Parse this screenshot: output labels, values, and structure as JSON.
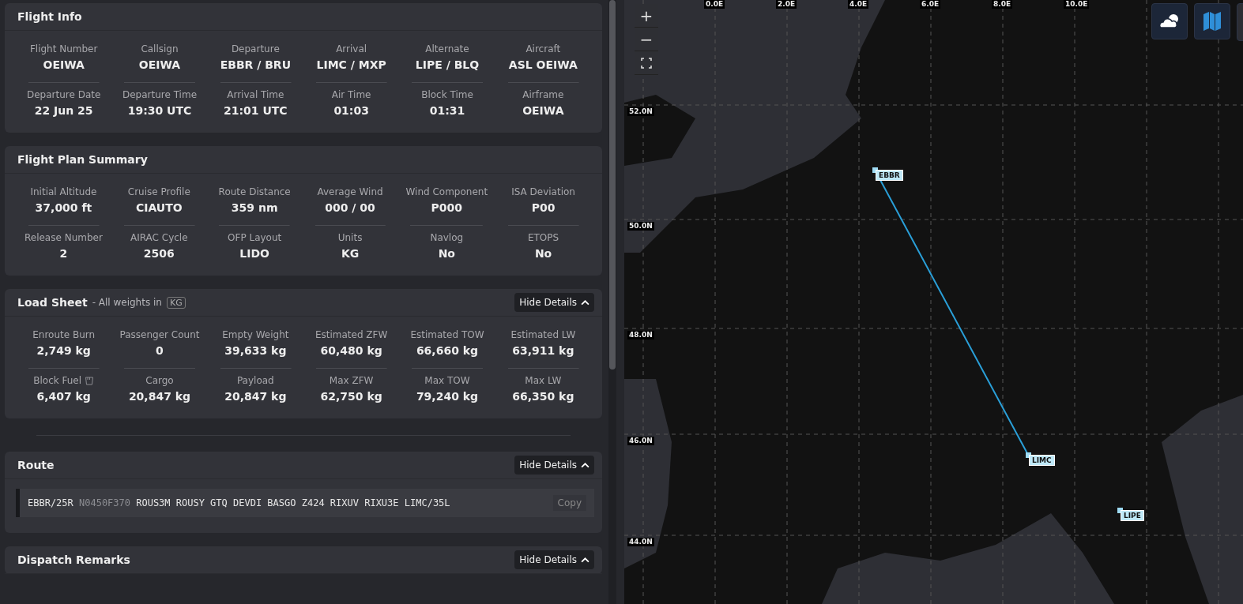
{
  "info_panel": {
    "sections": [
      {
        "kind": "grid",
        "title": "Flight Info",
        "rows": [
          [
            {
              "label": "Flight Number",
              "value": "OEIWA"
            },
            {
              "label": "Callsign",
              "value": "OEIWA"
            },
            {
              "label": "Departure",
              "value": "EBBR / BRU"
            },
            {
              "label": "Arrival",
              "value": "LIMC / MXP"
            },
            {
              "label": "Alternate",
              "value": "LIPE / BLQ"
            },
            {
              "label": "Aircraft",
              "value": "ASL OEIWA"
            }
          ],
          [
            {
              "label": "Departure Date",
              "value": "22 Jun 25"
            },
            {
              "label": "Departure Time",
              "value": "19:30 UTC"
            },
            {
              "label": "Arrival Time",
              "value": "21:01 UTC"
            },
            {
              "label": "Air Time",
              "value": "01:03"
            },
            {
              "label": "Block Time",
              "value": "01:31"
            },
            {
              "label": "Airframe",
              "value": "OEIWA"
            }
          ]
        ]
      },
      {
        "kind": "grid",
        "title": "Flight Plan Summary",
        "rows": [
          [
            {
              "label": "Initial Altitude",
              "value": "37,000 ft"
            },
            {
              "label": "Cruise Profile",
              "value": "CIAUTO"
            },
            {
              "label": "Route Distance",
              "value": "359 nm"
            },
            {
              "label": "Average Wind",
              "value": "000 / 00"
            },
            {
              "label": "Wind Component",
              "value": "P000"
            },
            {
              "label": "ISA Deviation",
              "value": "P00"
            }
          ],
          [
            {
              "label": "Release Number",
              "value": "2"
            },
            {
              "label": "AIRAC Cycle",
              "value": "2506"
            },
            {
              "label": "OFP Layout",
              "value": "LIDO"
            },
            {
              "label": "Units",
              "value": "KG"
            },
            {
              "label": "Navlog",
              "value": "No"
            },
            {
              "label": "ETOPS",
              "value": "No"
            }
          ]
        ]
      },
      {
        "kind": "grid",
        "title": "Load Sheet",
        "subtitle": "- All weights in",
        "unit_badge": "KG",
        "toggle": {
          "label": "Hide Details",
          "expanded": true
        },
        "rows": [
          [
            {
              "label": "Enroute Burn",
              "value": "2,749 kg"
            },
            {
              "label": "Passenger Count",
              "value": "0"
            },
            {
              "label": "Empty Weight",
              "value": "39,633 kg"
            },
            {
              "label": "Estimated ZFW",
              "value": "60,480 kg"
            },
            {
              "label": "Estimated TOW",
              "value": "66,660 kg"
            },
            {
              "label": "Estimated LW",
              "value": "63,911 kg"
            }
          ],
          [
            {
              "label": "Block Fuel",
              "value": "6,407 kg",
              "info_icon": true
            },
            {
              "label": "Cargo",
              "value": "20,847 kg"
            },
            {
              "label": "Payload",
              "value": "20,847 kg"
            },
            {
              "label": "Max ZFW",
              "value": "62,750 kg"
            },
            {
              "label": "Max TOW",
              "value": "79,240 kg"
            },
            {
              "label": "Max LW",
              "value": "66,350 kg"
            }
          ]
        ]
      },
      {
        "kind": "route",
        "title": "Route",
        "toggle": {
          "label": "Hide Details",
          "expanded": true
        },
        "route": {
          "segments": [
            {
              "text": "EBBR/25R",
              "muted": false
            },
            {
              "text": "N0450F370",
              "muted": true
            },
            {
              "text": "ROUS3M ROUSY GTQ DEVDI BASGO Z424 RIXUV RIXU3E LIMC/35L",
              "muted": false
            }
          ],
          "copy_button": "Copy"
        }
      },
      {
        "kind": "remarks",
        "title": "Dispatch Remarks",
        "toggle": {
          "label": "Hide Details",
          "expanded": true
        }
      }
    ]
  },
  "map": {
    "zoom_in": "+",
    "zoom_out": "−",
    "lon_labels": [
      "0.0E",
      "2.0E",
      "4.0E",
      "6.0E",
      "8.0E",
      "10.0E"
    ],
    "lat_labels": [
      "52.0N",
      "50.0N",
      "48.0N",
      "46.0N",
      "44.0N"
    ],
    "airports": [
      {
        "code": "EBBR"
      },
      {
        "code": "LIMC"
      },
      {
        "code": "LIPE"
      }
    ]
  }
}
